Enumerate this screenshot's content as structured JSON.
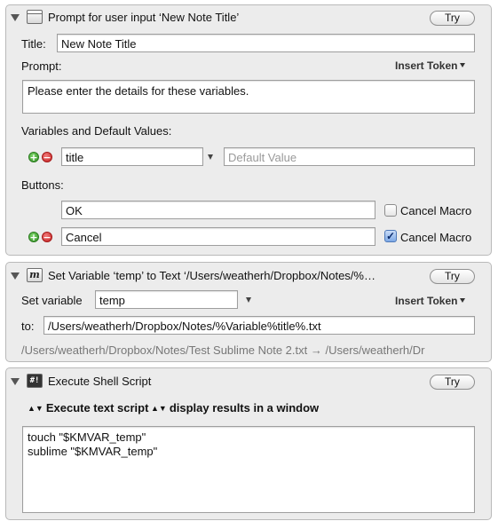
{
  "prompt_action": {
    "title": "Prompt for user input ‘New Note Title’",
    "try_label": "Try",
    "title_label": "Title:",
    "title_value": "New Note Title",
    "prompt_label": "Prompt:",
    "insert_token_label": "Insert Token",
    "prompt_text": "Please enter the details for these variables.",
    "variables_label": "Variables and Default Values:",
    "variable": {
      "name": "title",
      "default_placeholder": "Default Value"
    },
    "buttons_label": "Buttons:",
    "buttons": [
      {
        "value": "OK",
        "cancel_label": "Cancel Macro",
        "cancel_checked": false
      },
      {
        "value": "Cancel",
        "cancel_label": "Cancel Macro",
        "cancel_checked": true
      }
    ]
  },
  "setvar_action": {
    "title": "Set Variable ‘temp’ to Text ‘/Users/weatherh/Dropbox/Notes/%…",
    "try_label": "Try",
    "set_variable_label": "Set variable",
    "variable_value": "temp",
    "insert_token_label": "Insert Token",
    "to_label": "to:",
    "to_value": "/Users/weatherh/Dropbox/Notes/%Variable%title%.txt",
    "preview": "/Users/weatherh/Dropbox/Notes/Test Sublime Note 2.txt → /Users/weatherh/Dr"
  },
  "shell_action": {
    "title": "Execute Shell Script",
    "try_label": "Try",
    "mode_option": "Execute text script",
    "output_option": "display results in a window",
    "script": "touch \"$KMVAR_temp\"\nsublime \"$KMVAR_temp\""
  },
  "icons": {
    "prompt": "window-icon",
    "setvar": "variable-m-icon",
    "shell": "shell-script-icon"
  },
  "glyphs": {
    "add": "+",
    "remove": "−",
    "check": "✓",
    "var_icon": "m",
    "shell_icon": "#!",
    "updown": "▲▼"
  },
  "colors": {
    "panel_bg": "#ececec",
    "add_green": "#2f8f22",
    "remove_red": "#c21d1d",
    "checkbox_blue": "#7ea9e6"
  }
}
